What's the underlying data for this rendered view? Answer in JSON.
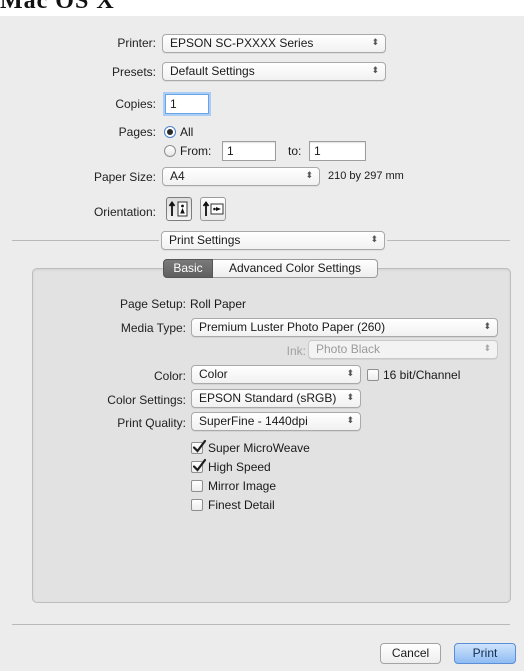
{
  "header": {
    "title": "Mac OS X"
  },
  "printer": {
    "label": "Printer:",
    "value": "EPSON SC-PXXXX Series"
  },
  "presets": {
    "label": "Presets:",
    "value": "Default Settings"
  },
  "copies": {
    "label": "Copies:",
    "value": "1"
  },
  "pages": {
    "label": "Pages:",
    "all_label": "All",
    "from_label": "From:",
    "from_value": "1",
    "to_label": "to:",
    "to_value": "1",
    "selected": "All"
  },
  "paper_size": {
    "label": "Paper Size:",
    "value": "A4",
    "dimensions": "210 by 297 mm"
  },
  "orientation": {
    "label": "Orientation:",
    "selected": "portrait"
  },
  "section_popup": {
    "value": "Print Settings"
  },
  "tabs": [
    {
      "label": "Basic",
      "active": true
    },
    {
      "label": "Advanced Color Settings",
      "active": false
    }
  ],
  "basic": {
    "page_setup": {
      "label": "Page Setup:",
      "value": "Roll Paper"
    },
    "media_type": {
      "label": "Media Type:",
      "value": "Premium Luster Photo Paper (260)"
    },
    "ink": {
      "label": "Ink:",
      "value": "Photo Black",
      "enabled": false
    },
    "color": {
      "label": "Color:",
      "value": "Color"
    },
    "bit16": {
      "label": "16 bit/Channel",
      "checked": false
    },
    "color_settings": {
      "label": "Color Settings:",
      "value": "EPSON Standard (sRGB)"
    },
    "print_quality": {
      "label": "Print Quality:",
      "value": "SuperFine - 1440dpi"
    },
    "options": [
      {
        "label": "Super MicroWeave",
        "checked": true
      },
      {
        "label": "High Speed",
        "checked": true
      },
      {
        "label": "Mirror Image",
        "checked": false
      },
      {
        "label": "Finest Detail",
        "checked": false
      }
    ]
  },
  "footer": {
    "cancel_label": "Cancel",
    "print_label": "Print"
  },
  "colors": {
    "accent": "#5b8ed6",
    "background": "#ececec",
    "panel": "#e2e2e2"
  },
  "icons": {
    "popup": "up-down-arrows-icon",
    "check": "checkmark-icon",
    "portrait": "portrait-orientation-icon",
    "landscape": "landscape-orientation-icon"
  }
}
